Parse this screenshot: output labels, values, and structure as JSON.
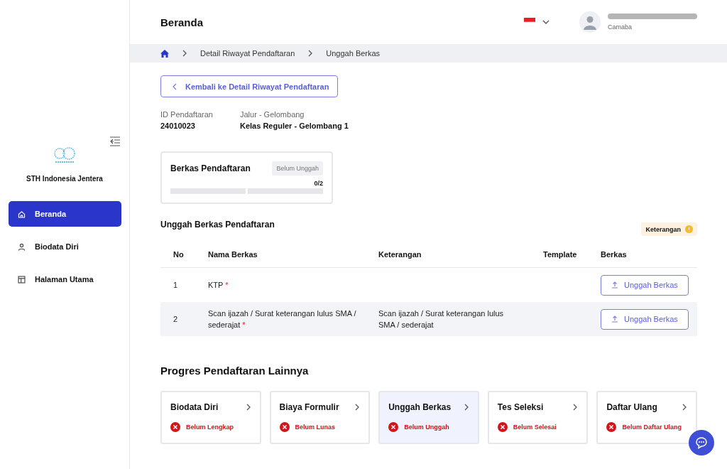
{
  "sidebar": {
    "brand": "STH Indonesia Jentera",
    "items": [
      {
        "label": "Beranda",
        "selected": true
      },
      {
        "label": "Biodata Diri",
        "selected": false
      },
      {
        "label": "Halaman Utama",
        "selected": false
      }
    ]
  },
  "header": {
    "title": "Beranda",
    "user_role": "Camaba"
  },
  "breadcrumb": [
    "Detail Riwayat Pendaftaran",
    "Unggah Berkas"
  ],
  "back_button": "Kembali ke Detail Riwayat Pendaftaran",
  "info": [
    {
      "label": "ID Pendaftaran",
      "value": "24010023"
    },
    {
      "label": "Jalur - Gelombang",
      "value": "Kelas Reguler - Gelombang 1"
    }
  ],
  "files_card": {
    "title": "Berkas Pendaftaran",
    "status": "Belum Unggah",
    "count": "0/2",
    "segments": [
      {
        "filled": false
      },
      {
        "filled": false
      }
    ]
  },
  "upload_section": {
    "title": "Unggah Berkas Pendaftaran",
    "legend": "Keterangan",
    "columns": [
      "No",
      "Nama Berkas",
      "Keterangan",
      "Template",
      "Berkas"
    ],
    "rows": [
      {
        "no": "1",
        "name": "KTP",
        "required_mark": "*",
        "description": "",
        "action": "Unggah Berkas"
      },
      {
        "no": "2",
        "name": "Scan ijazah / Surat keterangan lulus SMA / sederajat",
        "required_mark": "*",
        "description": "Scan ijazah / Surat keterangan lulus SMA / sederajat",
        "action": "Unggah Berkas"
      }
    ]
  },
  "progress": {
    "title": "Progres Pendaftaran Lainnya",
    "steps": [
      {
        "title": "Biodata Diri",
        "status": "Belum Lengkap",
        "selected": false
      },
      {
        "title": "Biaya Formulir",
        "status": "Belum Lunas",
        "selected": false
      },
      {
        "title": "Unggah Berkas",
        "status": "Belum Unggah",
        "selected": true
      },
      {
        "title": "Tes Seleksi",
        "status": "Belum Selesai",
        "selected": false
      },
      {
        "title": "Daftar Ulang",
        "status": "Belum Daftar Ulang",
        "selected": false
      }
    ]
  }
}
